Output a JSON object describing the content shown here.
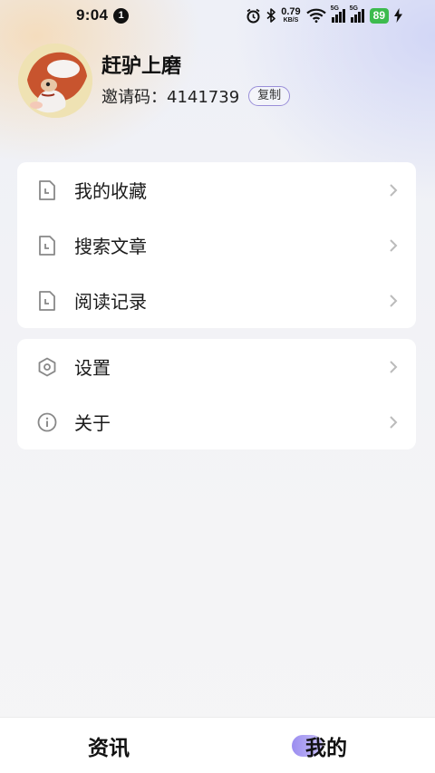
{
  "status_bar": {
    "time": "9:04",
    "notification_count": "1",
    "net_speed_value": "0.79",
    "net_speed_unit": "KB/S",
    "signal_1_tag": "5G",
    "signal_2_tag": "5G",
    "battery": "89",
    "icons": [
      "alarm-icon",
      "bluetooth-icon",
      "wifi-icon",
      "signal-icon",
      "signal-icon",
      "battery-icon",
      "charging-icon"
    ]
  },
  "profile": {
    "nickname": "赶驴上磨",
    "invite_text": "邀请码：4141739",
    "copy_label": "复制"
  },
  "menu_group_1": [
    {
      "label": "我的收藏",
      "icon": "document-icon"
    },
    {
      "label": "搜索文章",
      "icon": "document-icon"
    },
    {
      "label": "阅读记录",
      "icon": "document-icon"
    }
  ],
  "menu_group_2": [
    {
      "label": "设置",
      "icon": "settings-hexagon-icon"
    },
    {
      "label": "关于",
      "icon": "info-circle-icon"
    }
  ],
  "tab_bar": {
    "tabs": [
      {
        "label": "资讯",
        "active": false
      },
      {
        "label": "我的",
        "active": true
      }
    ],
    "accent_color": "#9b8df0"
  },
  "colors": {
    "battery_green": "#3dbb4e",
    "copy_border": "#9a8fd9"
  }
}
